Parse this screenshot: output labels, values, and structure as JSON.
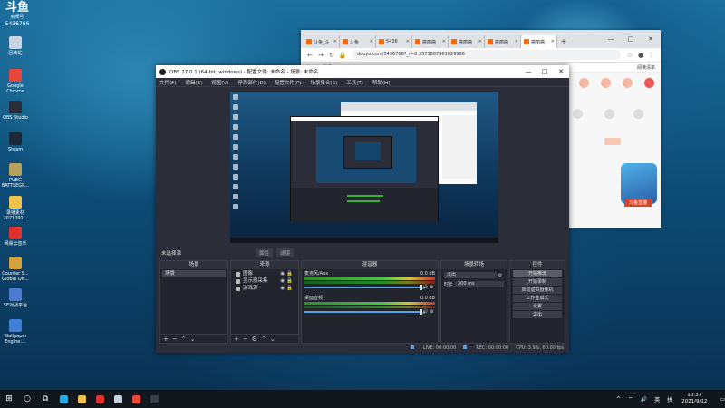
{
  "desktop": {
    "logo": {
      "title": "斗鱼",
      "subtitle": "房间号",
      "room": "5436766"
    },
    "icons": [
      {
        "label": "回收站",
        "color": "#c9d4df"
      },
      {
        "label": "Google Chrome",
        "color": "#e8453c"
      },
      {
        "label": "OBS Studio",
        "color": "#2b2e38"
      },
      {
        "label": "Steam",
        "color": "#1b2838"
      },
      {
        "label": "PUBG BATTLEGR...",
        "color": "#b8a15a"
      },
      {
        "label": "录播素材 2021091...",
        "color": "#f0c24a"
      },
      {
        "label": "网易云音乐",
        "color": "#e03030"
      },
      {
        "label": "Counter S... Global Off...",
        "color": "#d6a33a"
      },
      {
        "label": "5E对战平台",
        "color": "#4a7bd0"
      },
      {
        "label": "Wallpaper Engine:...",
        "color": "#3f7fd6"
      }
    ]
  },
  "browser": {
    "tabs": [
      {
        "label": "斗鱼_斗"
      },
      {
        "label": "斗鱼"
      },
      {
        "label": "5436"
      },
      {
        "label": "斋丽斋"
      },
      {
        "label": "斋丽斋"
      },
      {
        "label": "斋丽斋"
      },
      {
        "label": "斋丽斋"
      }
    ],
    "address": "douyu.com/5436766?_r=0.3373887961029986",
    "bookmarks": [
      "应用",
      "翻译"
    ],
    "bookmarks_right": "阅读清单",
    "new_tab": "+",
    "window_buttons": [
      "—",
      "□",
      "✕"
    ],
    "mascot_label": "斗鱼直播"
  },
  "obs": {
    "title": "OBS 27.0.1 (64-bit, windows) - 配置文件: 未命名 - 场景: 未命名",
    "window_buttons": [
      "—",
      "□",
      "✕"
    ],
    "menu": [
      "文件(F)",
      "编辑(E)",
      "视图(V)",
      "停靠部件(D)",
      "配置文件(P)",
      "场景集合(S)",
      "工具(T)",
      "帮助(H)"
    ],
    "scene_label": "未选择源",
    "scene_props": [
      "属性",
      "滤镜"
    ],
    "docks": {
      "scenes": {
        "title": "场景",
        "items": [
          "场景"
        ]
      },
      "sources": {
        "title": "来源",
        "items": [
          {
            "label": "图像"
          },
          {
            "label": "显示器采集"
          },
          {
            "label": "游戏源"
          }
        ]
      },
      "mixer": {
        "title": "混音器",
        "channels": [
          {
            "name": "麦克风/Aux",
            "db": "0.0 dB"
          },
          {
            "name": "桌面音频",
            "db": "0.0 dB"
          }
        ]
      },
      "transitions": {
        "title": "场景转场",
        "type": "淡出",
        "duration_label": "时长",
        "duration": "300 ms"
      },
      "controls": {
        "title": "控件",
        "buttons": [
          "开始推流",
          "开始录制",
          "启动虚拟摄像机",
          "工作室模式",
          "设置",
          "退出"
        ]
      }
    },
    "status": {
      "live": "LIVE: 00:00:00",
      "rec": "REC: 00:00:00",
      "cpu": "CPU: 3.9%, 60.00 fps"
    }
  },
  "taskbar": {
    "apps": [
      {
        "name": "start",
        "color": "#ffffff"
      },
      {
        "name": "search",
        "color": "#ffffff"
      },
      {
        "name": "task-view",
        "color": "#ffffff"
      },
      {
        "name": "edge",
        "color": "#2fa6e0"
      },
      {
        "name": "explorer",
        "color": "#f0c24a"
      },
      {
        "name": "netease",
        "color": "#e03030"
      },
      {
        "name": "steam",
        "color": "#c6d4df"
      },
      {
        "name": "chrome",
        "color": "#e8453c"
      },
      {
        "name": "obs",
        "color": "#3a3d48"
      }
    ],
    "tray": [
      "^",
      "英",
      "拼"
    ],
    "time": "10:37",
    "date": "2021/9/12"
  }
}
